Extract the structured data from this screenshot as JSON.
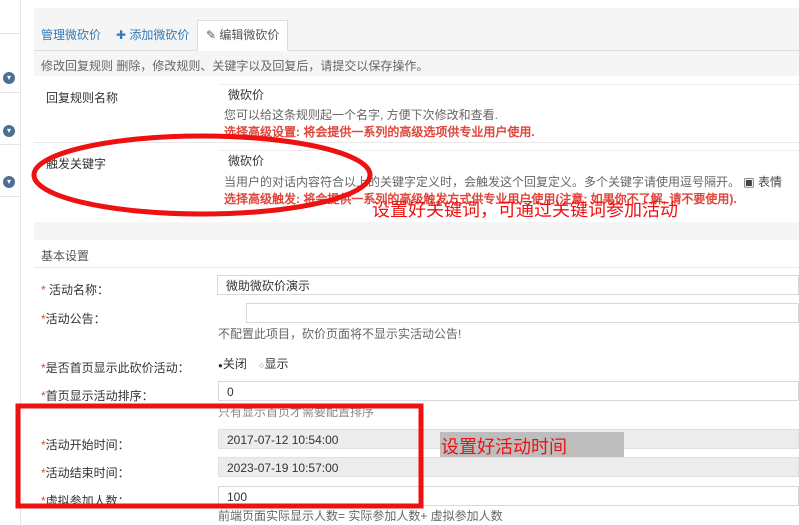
{
  "tabs": [
    {
      "label": "管理微砍价",
      "icon": ""
    },
    {
      "label": "添加微砍价",
      "icon": "plus-icon"
    },
    {
      "label": "编辑微砍价",
      "icon": "edit-icon"
    }
  ],
  "rule_hint": "修改回复规则 删除，修改规则、关键字以及回复后，请提交以保存操作。",
  "reply_rule": {
    "label": "回复规则名称",
    "value": "微砍价",
    "help": "您可以给这条规则起一个名字, 方便下次修改和查看.",
    "advanced": "选择高级设置: 将会提供一系列的高级选项供专业用户使用."
  },
  "keyword": {
    "label": "触发关键字",
    "value": "微砍价",
    "help": "当用户的对话内容符合以上的关键字定义时，会触发这个回复定义。多个关键字请使用逗号隔开。",
    "emoji_label": "表情",
    "advanced": "选择高级触发: 将会提供一系列的高级触发方式供专业用户使用(注意: 如果你不了解, 请不要使用)."
  },
  "basic": {
    "title": "基本设置",
    "name": {
      "label": "活动名称：",
      "value": "微助微砍价演示"
    },
    "notice": {
      "label": "活动公告：",
      "value": "",
      "help": "不配置此项目，砍价页面将不显示实活动公告!"
    },
    "home_show": {
      "label": "是否首页显示此砍价活动：",
      "options": [
        "关闭",
        "显示"
      ],
      "selected": "关闭"
    },
    "home_sort": {
      "label": "首页显示活动排序：",
      "value": "0",
      "help": "只有显示首页才需要配置排序"
    },
    "start_time": {
      "label": "活动开始时间：",
      "value": "2017-07-12 10:54:00"
    },
    "end_time": {
      "label": "活动结束时间：",
      "value": "2023-07-19 10:57:00"
    },
    "virtual": {
      "label": "虚拟参加人数：",
      "value": "100",
      "help": "前端页面实际显示人数= 实际参加人数+ 虚拟参加人数"
    }
  },
  "annotations": {
    "keyword_note": "设置好关键词，可通过关键词参加活动",
    "time_note": "设置好活动时间",
    "color": "#ee1111"
  }
}
